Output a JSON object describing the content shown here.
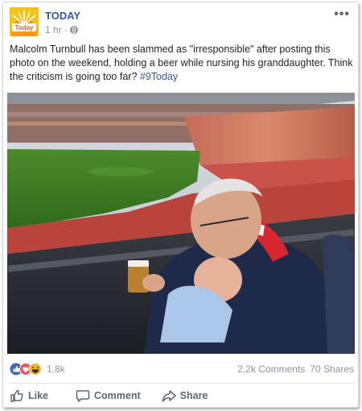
{
  "post": {
    "page_name": "TODAY",
    "time": "1 hr",
    "separator": "·",
    "more": "•••",
    "text_main": "Malcolm Turnbull has been slammed as \"irresponsible\" after posting this photo on the weekend, holding a beer while nursing his granddaughter. Think the criticism is going too far? ",
    "hashtag": "#9Today",
    "logo_text": "Today"
  },
  "reactions": {
    "icons": [
      "like-icon",
      "love-icon",
      "haha-icon"
    ],
    "count": "1.8k",
    "comments": "2.2k Comments",
    "shares": "70 Shares"
  },
  "actions": {
    "like": "Like",
    "comment": "Comment",
    "share": "Share"
  },
  "colors": {
    "link_blue": "#365899",
    "like_blue": "#4267b2",
    "love_red": "#f25268",
    "haha_yellow": "#f7b125",
    "logo_orange": "#f4b400"
  }
}
